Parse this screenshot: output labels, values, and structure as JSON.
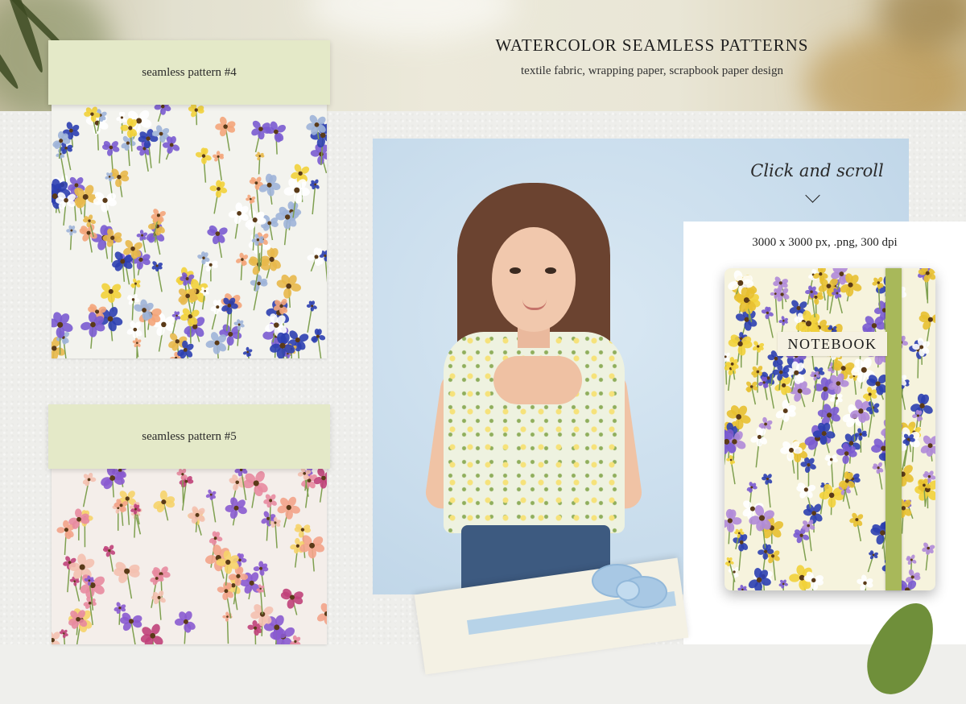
{
  "header": {
    "title": "WATERCOLOR SEAMLESS PATTERNS",
    "subtitle": "textile fabric, wrapping paper, scrapbook paper design"
  },
  "patterns": [
    {
      "label": "seamless pattern #4"
    },
    {
      "label": "seamless pattern #5"
    }
  ],
  "scroll_hint": {
    "text": "Click and scroll",
    "icon": "chevron-down-icon"
  },
  "product": {
    "spec": "3000 x 3000 px, .png, 300 dpi",
    "notebook_label": "NOTEBOOK"
  },
  "colors": {
    "label_bg": "#e4e9c8",
    "photo_bg": "#c8dcec",
    "band": "#a8b85a"
  }
}
